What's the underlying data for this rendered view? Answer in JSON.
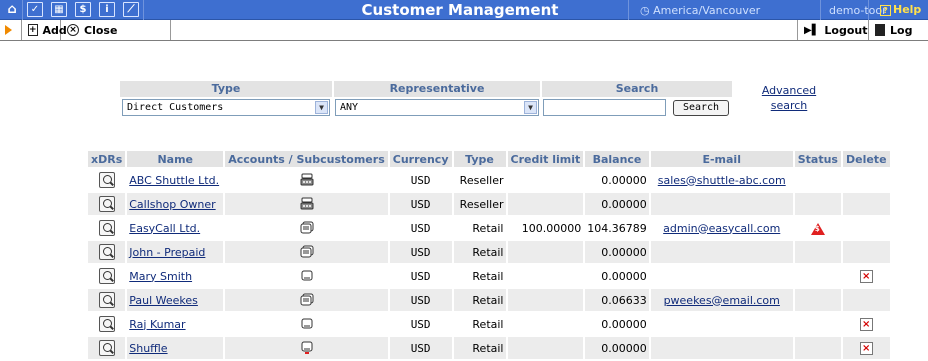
{
  "topbar": {
    "title": "Customer Management",
    "timezone": "America/Vancouver",
    "user": "demo-toor",
    "help": "Help"
  },
  "toolbar": {
    "add_label": "Add",
    "close_label": "Close",
    "logout_label": "Logout",
    "log_label": "Log"
  },
  "filter": {
    "type_header": "Type",
    "representative_header": "Representative",
    "search_header": "Search",
    "type_value": "Direct Customers",
    "representative_value": "ANY",
    "search_value": "",
    "search_button": "Search",
    "advanced_search": "Advanced search"
  },
  "table": {
    "columns": [
      "xDRs",
      "Name",
      "Accounts / Subcustomers",
      "Currency",
      "Type",
      "Credit limit",
      "Balance",
      "E-mail",
      "Status",
      "Delete"
    ],
    "rows": [
      {
        "name": "ABC Shuttle Ltd.",
        "account_icon": "reseller-icon",
        "currency": "USD",
        "type": "Reseller",
        "credit_limit": "",
        "balance": "0.00000",
        "email": "sales@shuttle-abc.com",
        "status": "",
        "delete": false
      },
      {
        "name": "Callshop Owner",
        "account_icon": "reseller-icon",
        "currency": "USD",
        "type": "Reseller",
        "credit_limit": "",
        "balance": "0.00000",
        "email": "",
        "status": "",
        "delete": false
      },
      {
        "name": "EasyCall Ltd.",
        "account_icon": "accounts-stack-icon",
        "currency": "USD",
        "type": "Retail",
        "credit_limit": "100.00000",
        "balance": "104.36789",
        "email": "admin@easycall.com",
        "status": "warning",
        "delete": false
      },
      {
        "name": "John - Prepaid",
        "account_icon": "accounts-stack-icon",
        "currency": "USD",
        "type": "Retail",
        "credit_limit": "",
        "balance": "0.00000",
        "email": "",
        "status": "",
        "delete": false
      },
      {
        "name": "Mary Smith",
        "account_icon": "no-account-icon",
        "currency": "USD",
        "type": "Retail",
        "credit_limit": "",
        "balance": "0.00000",
        "email": "",
        "status": "",
        "delete": true
      },
      {
        "name": "Paul Weekes",
        "account_icon": "accounts-stack-icon",
        "currency": "USD",
        "type": "Retail",
        "credit_limit": "",
        "balance": "0.06633",
        "email": "pweekes@email.com",
        "status": "",
        "delete": false
      },
      {
        "name": "Raj Kumar",
        "account_icon": "no-account-icon",
        "currency": "USD",
        "type": "Retail",
        "credit_limit": "",
        "balance": "0.00000",
        "email": "",
        "status": "",
        "delete": true
      },
      {
        "name": "Shuffle",
        "account_icon": "single-account-icon",
        "currency": "USD",
        "type": "Retail",
        "credit_limit": "",
        "balance": "0.00000",
        "email": "",
        "status": "",
        "delete": true
      }
    ]
  },
  "colors": {
    "topbar": "#3e6fd0",
    "header_text": "#4a6a9c",
    "link": "#102b7a",
    "help": "#ffe14d",
    "delete": "#d40000"
  }
}
